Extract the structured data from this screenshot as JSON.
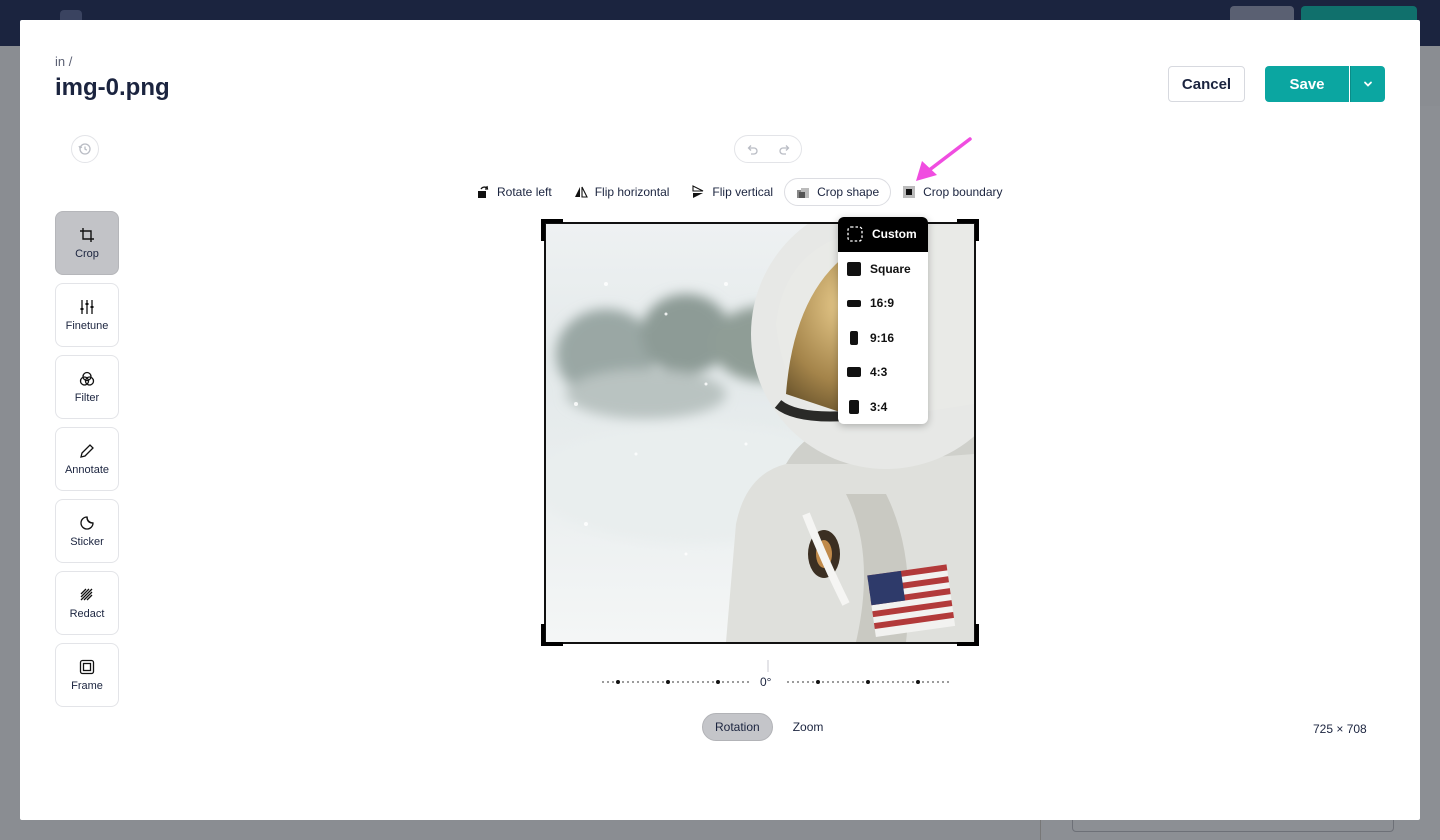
{
  "modal": {
    "breadcrumb": "in /",
    "title": "img-0.png",
    "cancel_label": "Cancel",
    "save_label": "Save"
  },
  "toolbar": {
    "rotate_left": "Rotate left",
    "flip_horizontal": "Flip horizontal",
    "flip_vertical": "Flip vertical",
    "crop_shape": "Crop shape",
    "crop_boundary": "Crop boundary"
  },
  "sidebar": {
    "items": [
      {
        "label": "Crop",
        "icon": "crop-icon",
        "active": true
      },
      {
        "label": "Finetune",
        "icon": "sliders-icon"
      },
      {
        "label": "Filter",
        "icon": "filter-icon"
      },
      {
        "label": "Annotate",
        "icon": "pencil-icon"
      },
      {
        "label": "Sticker",
        "icon": "sticker-icon"
      },
      {
        "label": "Redact",
        "icon": "redact-icon"
      },
      {
        "label": "Frame",
        "icon": "frame-icon"
      }
    ]
  },
  "crop_menu": {
    "items": [
      {
        "label": "Custom",
        "selected": true
      },
      {
        "label": "Square"
      },
      {
        "label": "16:9"
      },
      {
        "label": "9:16"
      },
      {
        "label": "4:3"
      },
      {
        "label": "3:4"
      }
    ]
  },
  "rotation": {
    "value": "0°"
  },
  "tabs": {
    "rotation": "Rotation",
    "zoom": "Zoom"
  },
  "image_size": "725 × 708",
  "colors": {
    "accent": "#0ba6a1",
    "annotation_arrow": "#f04de0",
    "header": "#1b243f"
  }
}
